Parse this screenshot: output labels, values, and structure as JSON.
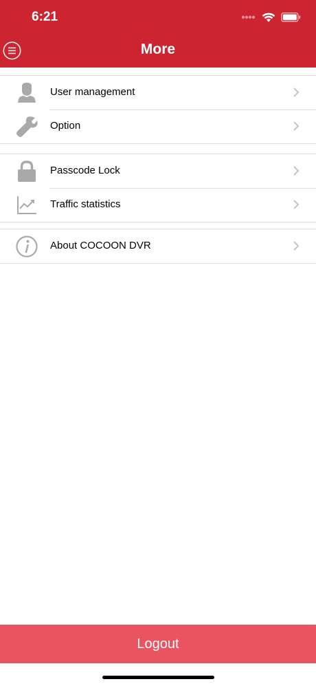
{
  "status_bar": {
    "time": "6:21"
  },
  "header": {
    "title": "More",
    "menu_icon": "menu-icon"
  },
  "groups": [
    {
      "items": [
        {
          "label": "User management",
          "icon": "user-icon"
        },
        {
          "label": "Option",
          "icon": "wrench-icon"
        }
      ]
    },
    {
      "items": [
        {
          "label": "Passcode Lock",
          "icon": "lock-icon"
        },
        {
          "label": "Traffic statistics",
          "icon": "chart-icon"
        }
      ]
    },
    {
      "items": [
        {
          "label": "About COCOON DVR",
          "icon": "info-icon"
        }
      ]
    }
  ],
  "footer": {
    "logout_label": "Logout"
  },
  "colors": {
    "header": "#cc2431",
    "logout": "#ea5461",
    "icon": "#a9a9a9",
    "chevron": "#c4c4c7"
  }
}
